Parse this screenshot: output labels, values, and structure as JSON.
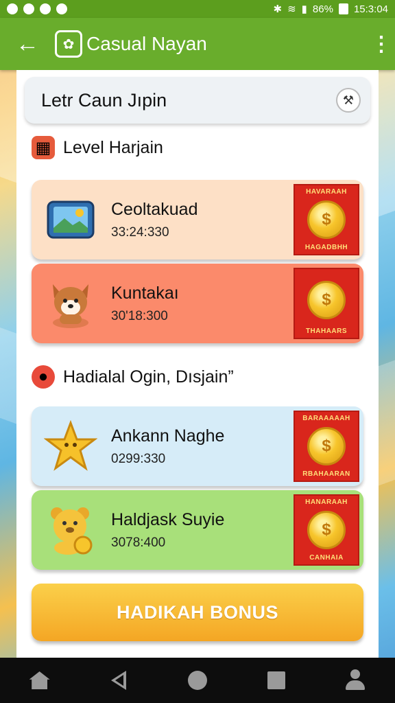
{
  "status_bar": {
    "battery": "86%",
    "time": "15:3:04"
  },
  "app_bar": {
    "title": "Casual Nayan",
    "logo_char": "✿"
  },
  "search": {
    "text": "Letr Caun Jıpin",
    "action_icon": "hammer-icon"
  },
  "sections": [
    {
      "title": "Level Harjain",
      "icon": "blocks-icon",
      "color": "#e65b3c"
    },
    {
      "title": "Hadialal Ogin, Dısjain”",
      "icon": "apple-icon",
      "color": "#e84a3a"
    }
  ],
  "cards": [
    {
      "name": "Ceoltakuad",
      "time": "33:24:330",
      "bg": "#fde0c6",
      "thumb_icon": "tablet-icon",
      "reward_top": "HAVARAAH",
      "reward_bottom": "HAGADBHH"
    },
    {
      "name": "Kuntakaı",
      "time": "30'18:300",
      "bg": "#fb8a6b",
      "thumb_icon": "dog-icon",
      "reward_top": "",
      "reward_bottom": "THAHAARS"
    },
    {
      "name": "Ankann Naghe",
      "time": "0299:330",
      "bg": "#d6ecf8",
      "thumb_icon": "star-icon",
      "reward_top": "BARAAAAAH",
      "reward_bottom": "RBAHAARAN"
    },
    {
      "name": "Haldjask Suyie",
      "time": "3078:400",
      "bg": "#a8e07a",
      "thumb_icon": "bear-icon",
      "reward_top": "HANARAAH",
      "reward_bottom": "CANHAIA"
    }
  ],
  "bonus_button": {
    "label": "HADIKAH BONUS"
  },
  "nav": [
    "home-icon",
    "back-icon",
    "home-circle-icon",
    "recents-icon",
    "profile-icon"
  ]
}
